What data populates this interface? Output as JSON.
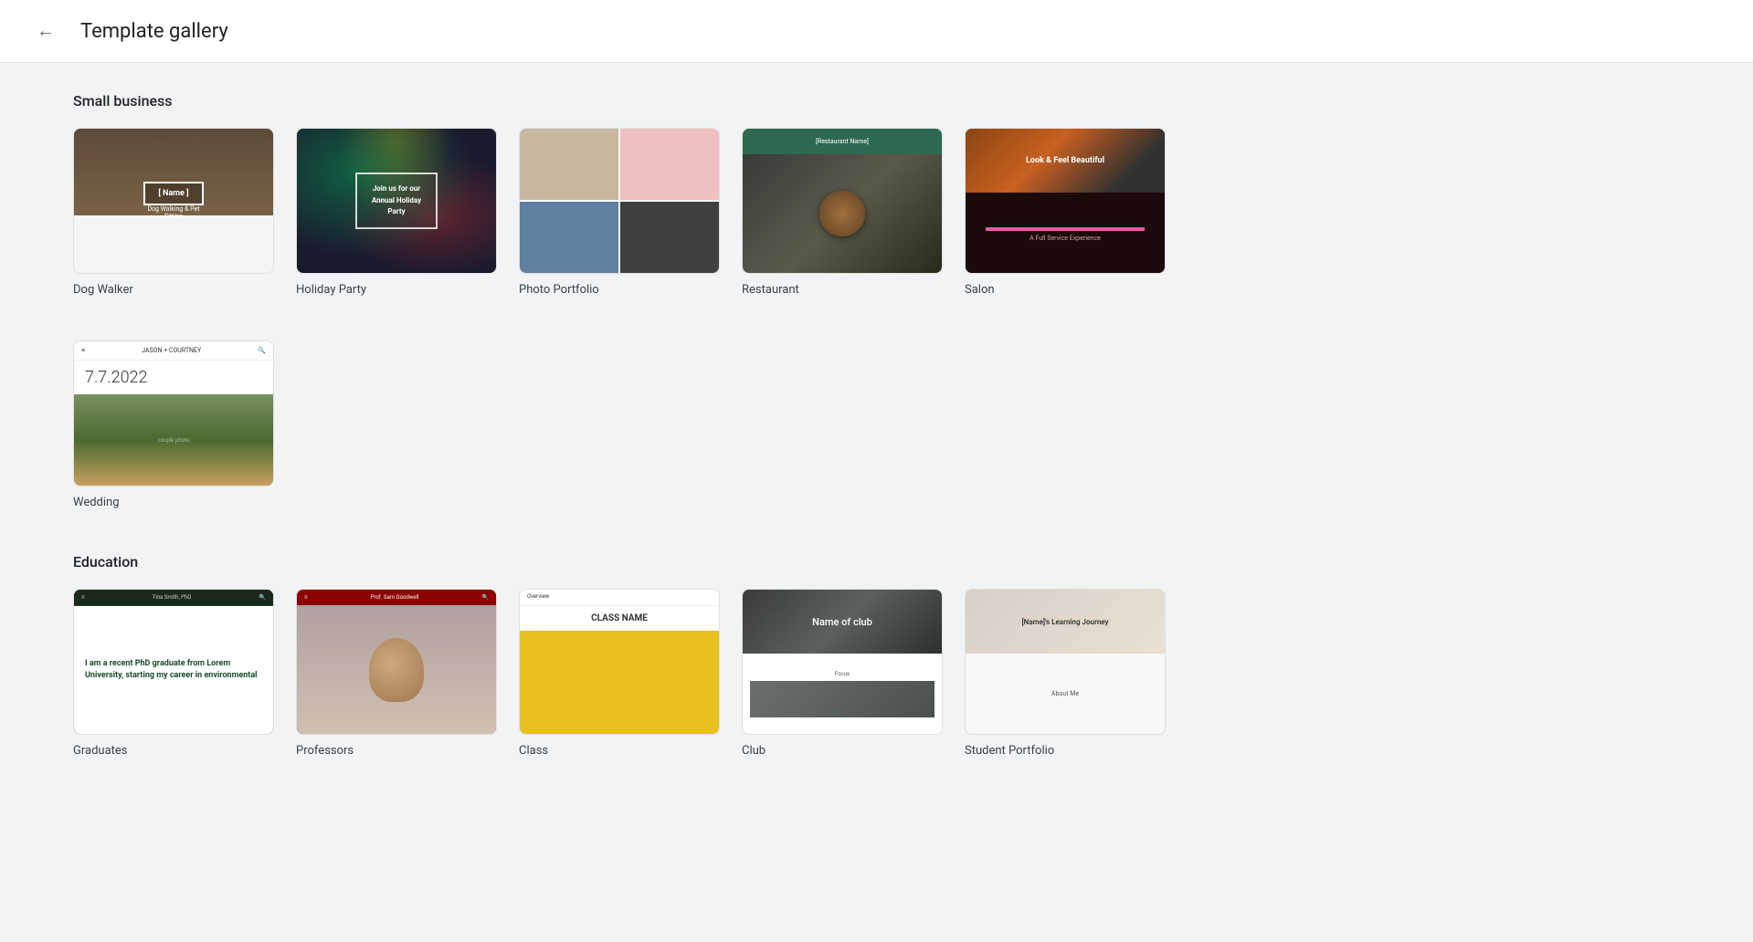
{
  "header": {
    "back_label": "←",
    "title": "Template gallery"
  },
  "sections": [
    {
      "id": "small-business",
      "title": "Small business",
      "templates": [
        {
          "id": "dog-walker",
          "name": "Dog Walker",
          "thumb_type": "dog-walker"
        },
        {
          "id": "holiday-party",
          "name": "Holiday Party",
          "thumb_type": "holiday"
        },
        {
          "id": "photo-portfolio",
          "name": "Photo Portfolio",
          "thumb_type": "photo"
        },
        {
          "id": "restaurant",
          "name": "Restaurant",
          "thumb_type": "restaurant"
        },
        {
          "id": "salon",
          "name": "Salon",
          "thumb_type": "salon"
        }
      ]
    },
    {
      "id": "small-business-2",
      "title": "",
      "templates": [
        {
          "id": "wedding",
          "name": "Wedding",
          "thumb_type": "wedding"
        }
      ]
    },
    {
      "id": "education",
      "title": "Education",
      "templates": [
        {
          "id": "graduates",
          "name": "Graduates",
          "thumb_type": "graduates"
        },
        {
          "id": "professors",
          "name": "Professors",
          "thumb_type": "professors"
        },
        {
          "id": "class",
          "name": "Class",
          "thumb_type": "class"
        },
        {
          "id": "club",
          "name": "Club",
          "thumb_type": "club"
        },
        {
          "id": "student-portfolio",
          "name": "Student Portfolio",
          "thumb_type": "student-portfolio"
        }
      ]
    }
  ],
  "thumb_texts": {
    "dog-walker": {
      "name": "[ Name ]",
      "sub1": "Dog Walking & Pet",
      "sub2": "Sitting"
    },
    "holiday": {
      "line1": "Join us for our",
      "line2": "Annual Holiday",
      "line3": "Party"
    },
    "restaurant": {
      "name": "[Restaurant Name]"
    },
    "salon": {
      "headline": "Look & Feel Beautiful",
      "sub": "A Full Service Experience"
    },
    "wedding": {
      "date": "7.7.2022",
      "names": "JASON + COURTNEY"
    },
    "graduates": {
      "body": "I am a recent PhD graduate from Lorem University, starting my career in environmental"
    },
    "professors": {
      "name": "Prof. Sam Goodwell"
    },
    "class": {
      "name": "CLASS NAME"
    },
    "club": {
      "name": "Name of club"
    },
    "student-portfolio": {
      "name": "[Name]'s Learning Journey"
    }
  }
}
